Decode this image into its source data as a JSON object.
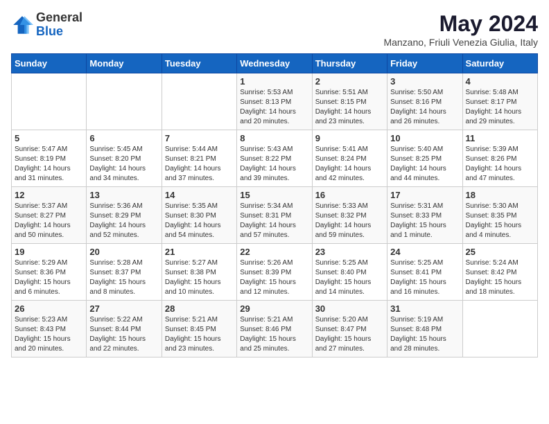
{
  "header": {
    "logo_general": "General",
    "logo_blue": "Blue",
    "month_year": "May 2024",
    "location": "Manzano, Friuli Venezia Giulia, Italy"
  },
  "weekdays": [
    "Sunday",
    "Monday",
    "Tuesday",
    "Wednesday",
    "Thursday",
    "Friday",
    "Saturday"
  ],
  "weeks": [
    [
      {
        "day": "",
        "sunrise": "",
        "sunset": "",
        "daylight": ""
      },
      {
        "day": "",
        "sunrise": "",
        "sunset": "",
        "daylight": ""
      },
      {
        "day": "",
        "sunrise": "",
        "sunset": "",
        "daylight": ""
      },
      {
        "day": "1",
        "sunrise": "Sunrise: 5:53 AM",
        "sunset": "Sunset: 8:13 PM",
        "daylight": "Daylight: 14 hours and 20 minutes."
      },
      {
        "day": "2",
        "sunrise": "Sunrise: 5:51 AM",
        "sunset": "Sunset: 8:15 PM",
        "daylight": "Daylight: 14 hours and 23 minutes."
      },
      {
        "day": "3",
        "sunrise": "Sunrise: 5:50 AM",
        "sunset": "Sunset: 8:16 PM",
        "daylight": "Daylight: 14 hours and 26 minutes."
      },
      {
        "day": "4",
        "sunrise": "Sunrise: 5:48 AM",
        "sunset": "Sunset: 8:17 PM",
        "daylight": "Daylight: 14 hours and 29 minutes."
      }
    ],
    [
      {
        "day": "5",
        "sunrise": "Sunrise: 5:47 AM",
        "sunset": "Sunset: 8:19 PM",
        "daylight": "Daylight: 14 hours and 31 minutes."
      },
      {
        "day": "6",
        "sunrise": "Sunrise: 5:45 AM",
        "sunset": "Sunset: 8:20 PM",
        "daylight": "Daylight: 14 hours and 34 minutes."
      },
      {
        "day": "7",
        "sunrise": "Sunrise: 5:44 AM",
        "sunset": "Sunset: 8:21 PM",
        "daylight": "Daylight: 14 hours and 37 minutes."
      },
      {
        "day": "8",
        "sunrise": "Sunrise: 5:43 AM",
        "sunset": "Sunset: 8:22 PM",
        "daylight": "Daylight: 14 hours and 39 minutes."
      },
      {
        "day": "9",
        "sunrise": "Sunrise: 5:41 AM",
        "sunset": "Sunset: 8:24 PM",
        "daylight": "Daylight: 14 hours and 42 minutes."
      },
      {
        "day": "10",
        "sunrise": "Sunrise: 5:40 AM",
        "sunset": "Sunset: 8:25 PM",
        "daylight": "Daylight: 14 hours and 44 minutes."
      },
      {
        "day": "11",
        "sunrise": "Sunrise: 5:39 AM",
        "sunset": "Sunset: 8:26 PM",
        "daylight": "Daylight: 14 hours and 47 minutes."
      }
    ],
    [
      {
        "day": "12",
        "sunrise": "Sunrise: 5:37 AM",
        "sunset": "Sunset: 8:27 PM",
        "daylight": "Daylight: 14 hours and 50 minutes."
      },
      {
        "day": "13",
        "sunrise": "Sunrise: 5:36 AM",
        "sunset": "Sunset: 8:29 PM",
        "daylight": "Daylight: 14 hours and 52 minutes."
      },
      {
        "day": "14",
        "sunrise": "Sunrise: 5:35 AM",
        "sunset": "Sunset: 8:30 PM",
        "daylight": "Daylight: 14 hours and 54 minutes."
      },
      {
        "day": "15",
        "sunrise": "Sunrise: 5:34 AM",
        "sunset": "Sunset: 8:31 PM",
        "daylight": "Daylight: 14 hours and 57 minutes."
      },
      {
        "day": "16",
        "sunrise": "Sunrise: 5:33 AM",
        "sunset": "Sunset: 8:32 PM",
        "daylight": "Daylight: 14 hours and 59 minutes."
      },
      {
        "day": "17",
        "sunrise": "Sunrise: 5:31 AM",
        "sunset": "Sunset: 8:33 PM",
        "daylight": "Daylight: 15 hours and 1 minute."
      },
      {
        "day": "18",
        "sunrise": "Sunrise: 5:30 AM",
        "sunset": "Sunset: 8:35 PM",
        "daylight": "Daylight: 15 hours and 4 minutes."
      }
    ],
    [
      {
        "day": "19",
        "sunrise": "Sunrise: 5:29 AM",
        "sunset": "Sunset: 8:36 PM",
        "daylight": "Daylight: 15 hours and 6 minutes."
      },
      {
        "day": "20",
        "sunrise": "Sunrise: 5:28 AM",
        "sunset": "Sunset: 8:37 PM",
        "daylight": "Daylight: 15 hours and 8 minutes."
      },
      {
        "day": "21",
        "sunrise": "Sunrise: 5:27 AM",
        "sunset": "Sunset: 8:38 PM",
        "daylight": "Daylight: 15 hours and 10 minutes."
      },
      {
        "day": "22",
        "sunrise": "Sunrise: 5:26 AM",
        "sunset": "Sunset: 8:39 PM",
        "daylight": "Daylight: 15 hours and 12 minutes."
      },
      {
        "day": "23",
        "sunrise": "Sunrise: 5:25 AM",
        "sunset": "Sunset: 8:40 PM",
        "daylight": "Daylight: 15 hours and 14 minutes."
      },
      {
        "day": "24",
        "sunrise": "Sunrise: 5:25 AM",
        "sunset": "Sunset: 8:41 PM",
        "daylight": "Daylight: 15 hours and 16 minutes."
      },
      {
        "day": "25",
        "sunrise": "Sunrise: 5:24 AM",
        "sunset": "Sunset: 8:42 PM",
        "daylight": "Daylight: 15 hours and 18 minutes."
      }
    ],
    [
      {
        "day": "26",
        "sunrise": "Sunrise: 5:23 AM",
        "sunset": "Sunset: 8:43 PM",
        "daylight": "Daylight: 15 hours and 20 minutes."
      },
      {
        "day": "27",
        "sunrise": "Sunrise: 5:22 AM",
        "sunset": "Sunset: 8:44 PM",
        "daylight": "Daylight: 15 hours and 22 minutes."
      },
      {
        "day": "28",
        "sunrise": "Sunrise: 5:21 AM",
        "sunset": "Sunset: 8:45 PM",
        "daylight": "Daylight: 15 hours and 23 minutes."
      },
      {
        "day": "29",
        "sunrise": "Sunrise: 5:21 AM",
        "sunset": "Sunset: 8:46 PM",
        "daylight": "Daylight: 15 hours and 25 minutes."
      },
      {
        "day": "30",
        "sunrise": "Sunrise: 5:20 AM",
        "sunset": "Sunset: 8:47 PM",
        "daylight": "Daylight: 15 hours and 27 minutes."
      },
      {
        "day": "31",
        "sunrise": "Sunrise: 5:19 AM",
        "sunset": "Sunset: 8:48 PM",
        "daylight": "Daylight: 15 hours and 28 minutes."
      },
      {
        "day": "",
        "sunrise": "",
        "sunset": "",
        "daylight": ""
      }
    ]
  ]
}
